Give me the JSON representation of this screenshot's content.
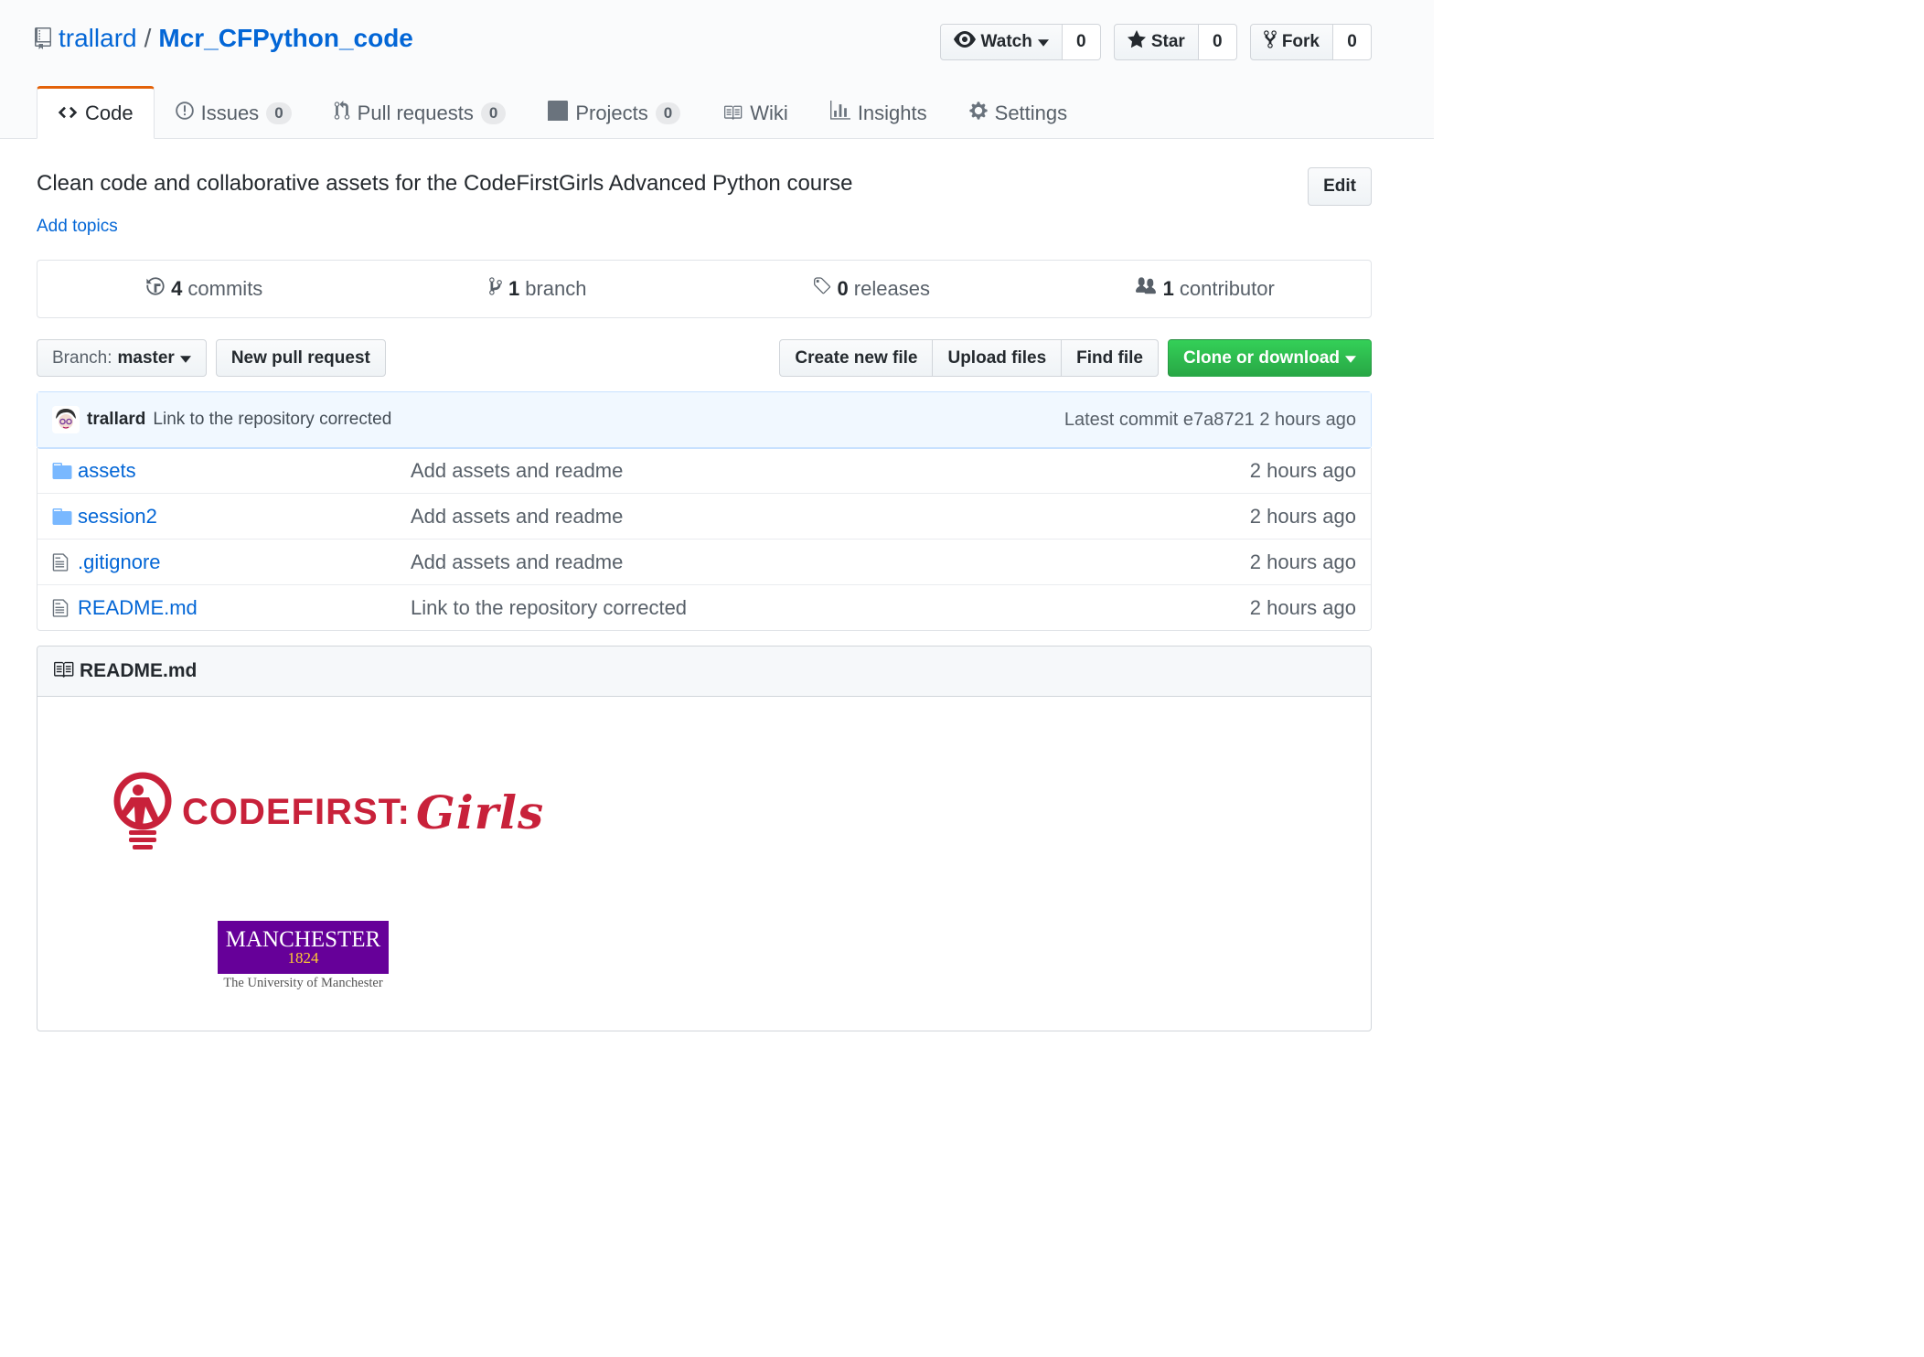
{
  "repo": {
    "owner": "trallard",
    "separator": "/",
    "name": "Mcr_CFPython_code"
  },
  "actions": {
    "watch_label": "Watch",
    "watch_count": "0",
    "star_label": "Star",
    "star_count": "0",
    "fork_label": "Fork",
    "fork_count": "0"
  },
  "tabs": [
    {
      "label": "Code",
      "icon": "code-icon"
    },
    {
      "label": "Issues",
      "count": "0",
      "icon": "issue-icon"
    },
    {
      "label": "Pull requests",
      "count": "0",
      "icon": "pull-request-icon"
    },
    {
      "label": "Projects",
      "count": "0",
      "icon": "project-icon"
    },
    {
      "label": "Wiki",
      "icon": "book-icon"
    },
    {
      "label": "Insights",
      "icon": "graph-icon"
    },
    {
      "label": "Settings",
      "icon": "gear-icon"
    }
  ],
  "description": "Clean code and collaborative assets for the CodeFirstGirls Advanced Python course",
  "edit_label": "Edit",
  "add_topics_label": "Add topics",
  "numbers": {
    "commits_num": "4",
    "commits_label": "commits",
    "branch_num": "1",
    "branch_label": "branch",
    "releases_num": "0",
    "releases_label": "releases",
    "contributors_num": "1",
    "contributors_label": "contributor"
  },
  "file_nav": {
    "branch_prefix": "Branch:",
    "branch_name": "master",
    "new_pr": "New pull request",
    "create_file": "Create new file",
    "upload_files": "Upload files",
    "find_file": "Find file",
    "clone": "Clone or download"
  },
  "commit": {
    "author": "trallard",
    "message": "Link to the repository corrected",
    "latest_label": "Latest commit",
    "sha": "e7a8721",
    "age": "2 hours ago"
  },
  "files": [
    {
      "name": "assets",
      "type": "folder",
      "message": "Add assets and readme",
      "age": "2 hours ago"
    },
    {
      "name": "session2",
      "type": "folder",
      "message": "Add assets and readme",
      "age": "2 hours ago"
    },
    {
      "name": ".gitignore",
      "type": "file",
      "message": "Add assets and readme",
      "age": "2 hours ago"
    },
    {
      "name": "README.md",
      "type": "file",
      "message": "Link to the repository corrected",
      "age": "2 hours ago"
    }
  ],
  "readme": {
    "title": "README.md",
    "cfg_text": "CODEFIRST:",
    "cfg_girls": "Girls",
    "man_name": "MANCHESTER",
    "man_year": "1824",
    "man_sub": "The University of Manchester"
  },
  "colors": {
    "link": "#0366d6",
    "tab_accent": "#e36209",
    "green": "#28a745",
    "cfg_red": "#c8213a",
    "man_purple": "#660099"
  }
}
